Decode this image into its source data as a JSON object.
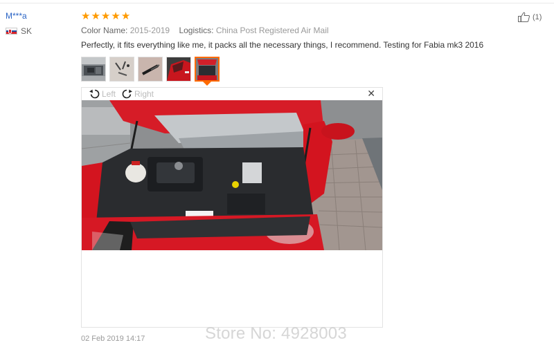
{
  "reviewer": {
    "name": "M***a",
    "country_code": "SK"
  },
  "review": {
    "rating": 5,
    "stars": [
      "★",
      "★",
      "★",
      "★",
      "★"
    ],
    "star_color": "#ff9a00",
    "color_label": "Color Name:",
    "color_value": "2015-2019",
    "logistics_label": "Logistics:",
    "logistics_value": "China Post Registered Air Mail",
    "text": "Perfectly, it fits everything like me, it packs all the necessary things, I recommend. Testing for Fabia mk3 2016",
    "date": "02 Feb 2019 14:17"
  },
  "thumbnails": [
    {
      "icon": "car-engine-thumb"
    },
    {
      "icon": "parts-thumb"
    },
    {
      "icon": "strut-thumb"
    },
    {
      "icon": "red-car-thumb"
    },
    {
      "icon": "engine-bay-thumb",
      "selected": true
    }
  ],
  "viewer": {
    "rotate_left_label": "Left",
    "rotate_right_label": "Right",
    "close_glyph": "✕",
    "photo_icon": "car-engine-bay-photo"
  },
  "helpful": {
    "count_text": "(1)",
    "icon": "thumbs-up-icon"
  },
  "watermark": "Store No: 4928003",
  "accent_color": "#ff6a00",
  "link_color": "#2a64c5"
}
